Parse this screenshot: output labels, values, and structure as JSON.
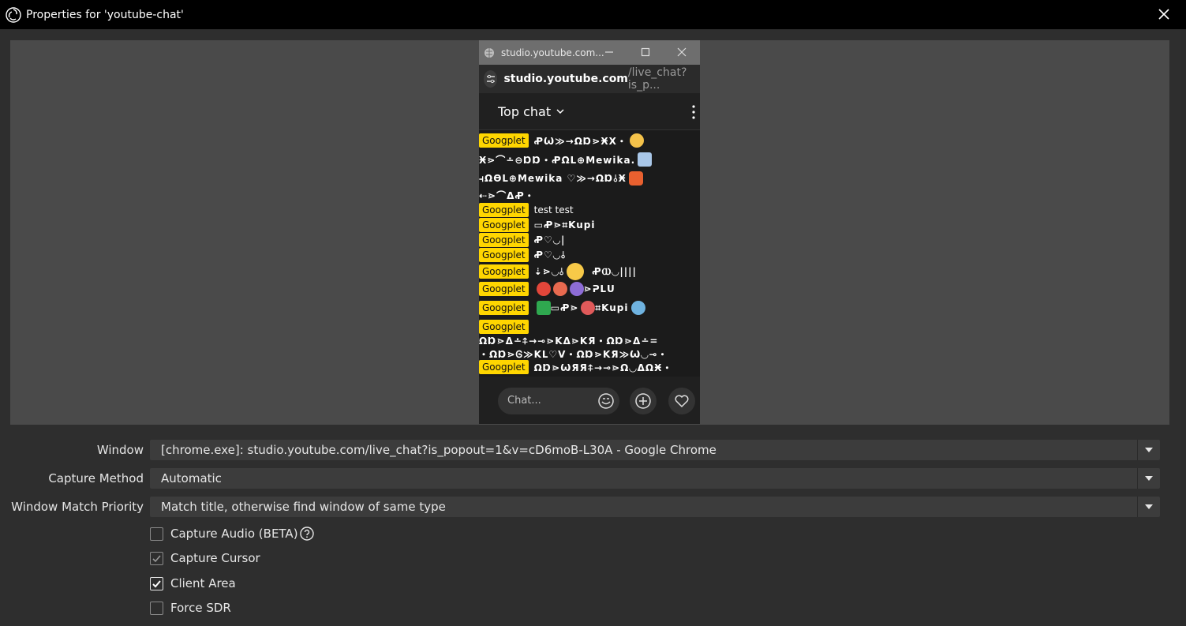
{
  "window": {
    "title": "Properties for 'youtube-chat'"
  },
  "capture": {
    "browser_tab": "studio.youtube.com...",
    "url_host": "studio.youtube.com",
    "url_path": "/live_chat?is_p...",
    "header": "Top chat",
    "chat_placeholder": "Chat...",
    "badge_label": "Googplet",
    "messages": [
      {
        "text": "ꝒѠ≫→ΩⱰ⋗ӾⅩ・"
      },
      {
        "text": "Ӿ⋗⌒∸⊖ⱰⱰ・ꝒΩᒪ⊕Mewika."
      },
      {
        "text": "⫞ΩӨᒪ⊕Mewika ♡≫→ΩⱰ⫰Ӿ"
      },
      {
        "text": "⇠⋗⌒ᐃꝒ・"
      },
      {
        "text": "test test"
      },
      {
        "text": "▭Ꝓ⋗⌗Kupi"
      },
      {
        "text": "Ꝓ♡◡|"
      },
      {
        "text": "Ꝓ♡◡⫰"
      },
      {
        "text": "⇣⋗◡⫰"
      },
      {
        "text": "ꝒⲰ◡||||"
      },
      {
        "text": "⋗ᕈᒪᑌ"
      },
      {
        "text": "▭Ꝓ⋗"
      },
      {
        "text": "⌗Kupi"
      },
      {
        "text": "ΩⱰ⋗ᐃ∸⍏→⊸⋗Kᐃ⋗KЯ・ΩⱰ⋗ᐃ∸="
      },
      {
        "text": "・ΩⱰ⋗Ꮆ≫Kᒪ♡V・ΩⱰ⋗KЯ≫Ѡ◡⊸・"
      },
      {
        "text": "ΩⱰ⋗ѠЯЯ⍏→⊸⋗Ω◡ᐃΩӾ・"
      }
    ]
  },
  "form": {
    "window_label": "Window",
    "window_value": "[chrome.exe]: studio.youtube.com/live_chat?is_popout=1&v=cD6moB-L30A - Google Chrome",
    "capture_method_label": "Capture Method",
    "capture_method_value": "Automatic",
    "match_priority_label": "Window Match Priority",
    "match_priority_value": "Match title, otherwise find window of same type",
    "checkboxes": [
      {
        "label": "Capture Audio (BETA)",
        "checked": false
      },
      {
        "label": "Capture Cursor",
        "checked": true
      },
      {
        "label": "Client Area",
        "checked": true
      },
      {
        "label": "Force SDR",
        "checked": false
      }
    ]
  },
  "colors": {
    "badge": "#ffd600",
    "titlebar": "#000000",
    "panel": "#2e2e2e",
    "preview": "#4a4a4a"
  }
}
